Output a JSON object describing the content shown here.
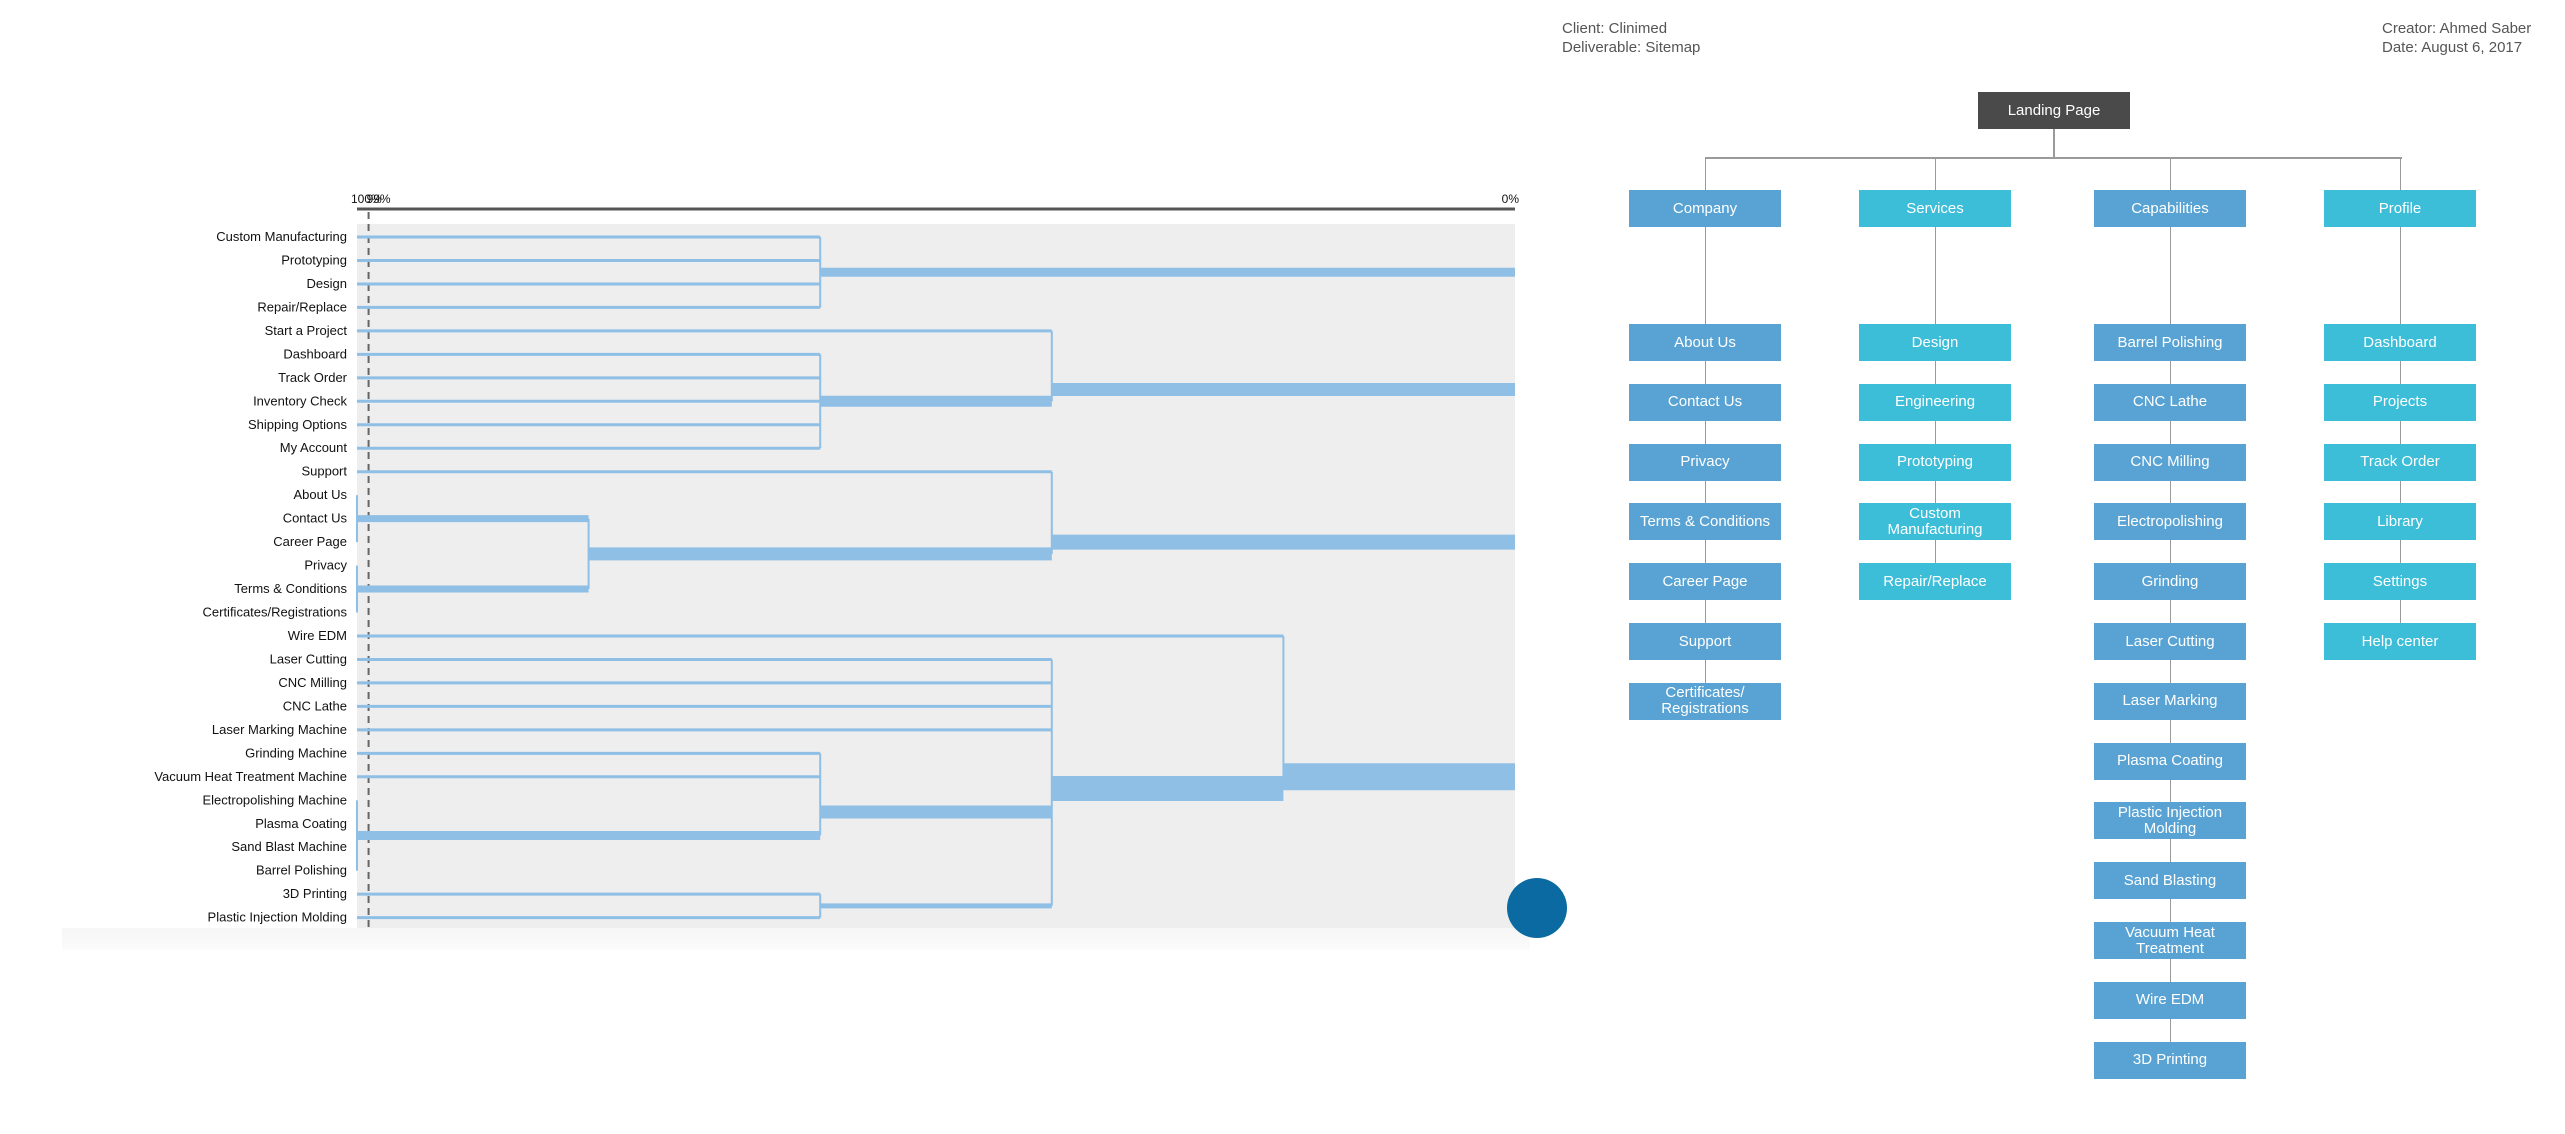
{
  "header": {
    "client": "Client: Clinimed",
    "deliverable": "Deliverable: Sitemap",
    "creator": "Creator: Ahmed Saber",
    "date": "Date: August 6, 2017"
  },
  "chart_data": {
    "type": "dendrogram",
    "axis": {
      "labels": [
        "100%",
        "99%",
        "0%"
      ],
      "range": [
        100,
        0
      ],
      "threshold": 99
    },
    "colors": {
      "links": "#8fbfe5",
      "background": "#eeeeee",
      "threshold": "#666666"
    },
    "leaves": [
      "Custom Manufacturing",
      "Prototyping",
      "Design",
      "Repair/Replace",
      "Start a Project",
      "Dashboard",
      "Track Order",
      "Inventory Check",
      "Shipping Options",
      "My Account",
      "Support",
      "About Us",
      "Contact Us",
      "Career Page",
      "Privacy",
      "Terms & Conditions",
      "Certificates/Registrations",
      "Wire EDM",
      "Laser Cutting",
      "CNC Milling",
      "CNC Lathe",
      "Laser Marking Machine",
      "Grinding Machine",
      "Vacuum Heat Treatment Machine",
      "Electropolishing Machine",
      "Plasma Coating",
      "Sand Blast Machine",
      "Barrel Polishing",
      "3D Printing",
      "Plastic Injection Molding"
    ],
    "tree": {
      "level": 0,
      "children": [
        {
          "level": 60,
          "children": [
            0,
            1,
            2,
            3
          ]
        },
        {
          "level": 40,
          "children": [
            4,
            {
              "level": 60,
              "children": [
                5,
                6,
                7,
                8,
                9
              ]
            }
          ]
        },
        {
          "level": 40,
          "children": [
            10,
            {
              "level": 80,
              "children": [
                {
                  "level": 100,
                  "children": [
                    11,
                    12,
                    13
                  ]
                },
                {
                  "level": 100,
                  "children": [
                    14,
                    15,
                    16
                  ]
                }
              ]
            }
          ]
        },
        {
          "level": 20,
          "children": [
            17,
            {
              "level": 40,
              "children": [
                18,
                19,
                20,
                21,
                {
                  "level": 60,
                  "children": [
                    22,
                    23,
                    {
                      "level": 100,
                      "children": [
                        24,
                        25,
                        26,
                        27
                      ]
                    }
                  ]
                },
                {
                  "level": 60,
                  "children": [
                    28,
                    29
                  ]
                }
              ]
            }
          ]
        }
      ]
    }
  },
  "sitemap": {
    "root": {
      "label": "Landing Page",
      "color": "#4a4a4a"
    },
    "line_color": "#9a9a9a",
    "sections": [
      {
        "label": "Company",
        "color": "#58a3d3",
        "children": [
          "About Us",
          "Contact Us",
          "Privacy",
          "Terms & Conditions",
          "Career Page",
          "Support",
          "Certificates/ Registrations"
        ]
      },
      {
        "label": "Services",
        "color": "#3cbdd8",
        "children": [
          "Design",
          "Engineering",
          "Prototyping",
          "Custom Manufacturing",
          "Repair/Replace"
        ]
      },
      {
        "label": "Capabilities",
        "color": "#58a3d3",
        "children": [
          "Barrel Polishing",
          "CNC Lathe",
          "CNC Milling",
          "Electropolishing",
          "Grinding",
          "Laser Cutting",
          "Laser Marking",
          "Plasma Coating",
          "Plastic Injection Molding",
          "Sand Blasting",
          "Vacuum Heat Treatment",
          "Wire EDM",
          "3D Printing"
        ]
      },
      {
        "label": "Profile",
        "color": "#3cbdd8",
        "children": [
          "Dashboard",
          "Projects",
          "Track Order",
          "Library",
          "Settings",
          "Help center"
        ]
      }
    ]
  },
  "help_button": {
    "icon": "chat-icon",
    "color": "#0a6aa1"
  }
}
